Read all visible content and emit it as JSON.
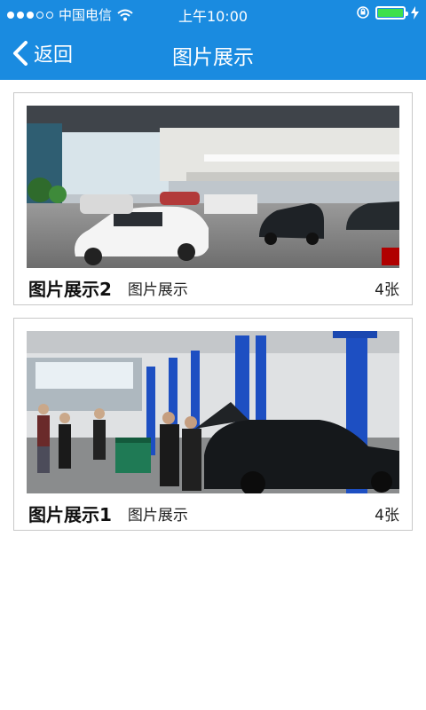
{
  "status": {
    "carrier": "中国电信",
    "time": "上午10:00"
  },
  "header": {
    "back_label": "返回",
    "title": "图片展示"
  },
  "albums": [
    {
      "name": "图片展示2",
      "subtitle": "图片展示",
      "count": "4张"
    },
    {
      "name": "图片展示1",
      "subtitle": "图片展示",
      "count": "4张"
    }
  ],
  "colors": {
    "accent": "#1a8be0",
    "battery": "#3ee04b"
  }
}
